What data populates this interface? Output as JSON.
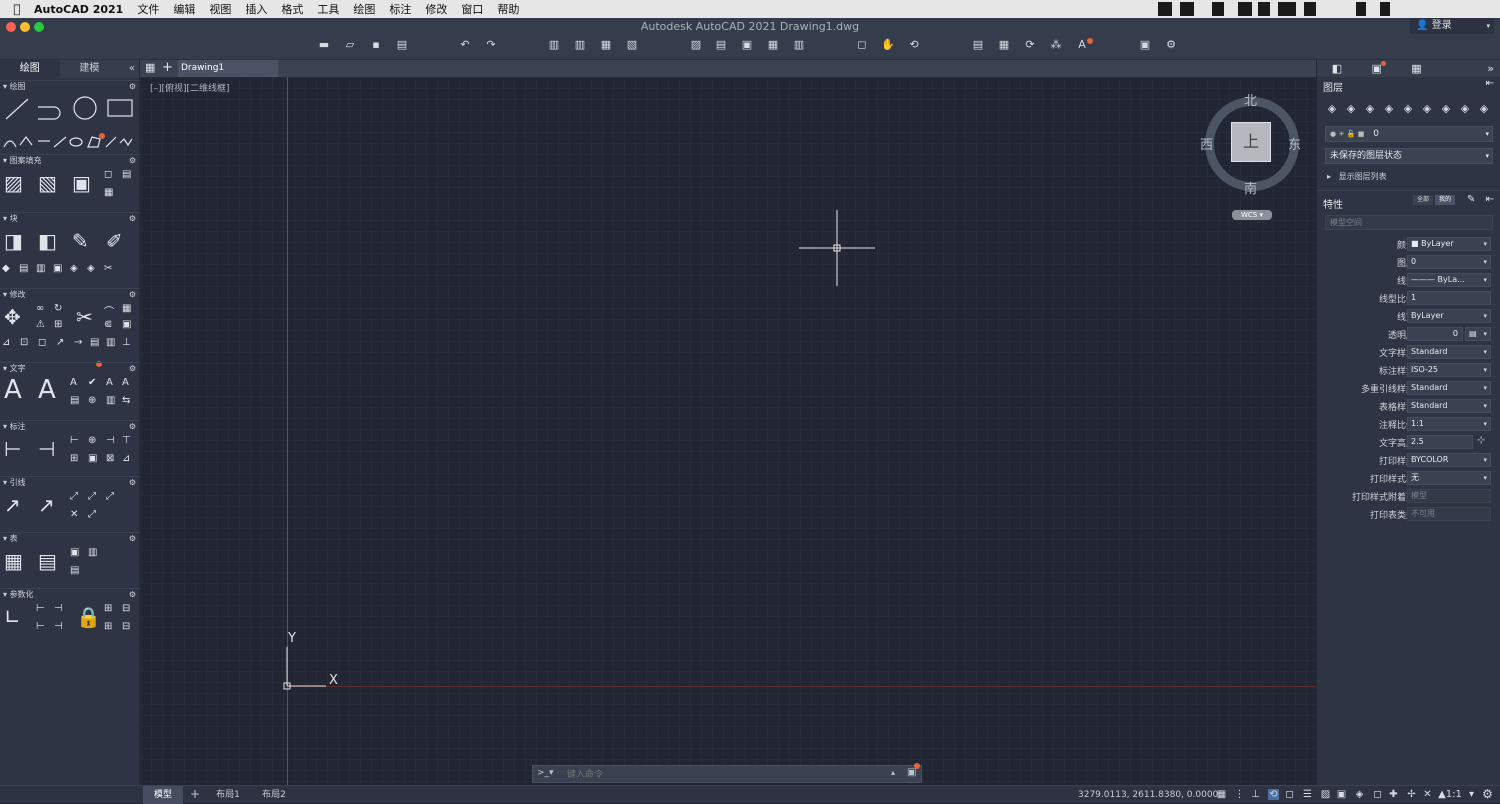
{
  "menubar": {
    "app": "AutoCAD 2021",
    "items": [
      "文件",
      "编辑",
      "视图",
      "插入",
      "格式",
      "工具",
      "绘图",
      "标注",
      "修改",
      "窗口",
      "帮助"
    ]
  },
  "window": {
    "title": "Autodesk AutoCAD 2021    Drawing1.dwg",
    "login": "登录"
  },
  "left_panel": {
    "tabs": [
      "绘图",
      "建模"
    ],
    "sections": [
      "绘图",
      "图案填充",
      "块",
      "修改",
      "文字",
      "标注",
      "引线",
      "表",
      "参数化"
    ]
  },
  "drawing_tabs": {
    "active": "Drawing1"
  },
  "canvas": {
    "view_label": "[–][俯视][二维线框]",
    "compass": {
      "north": "北",
      "south": "南",
      "east": "东",
      "west": "西",
      "top": "上"
    },
    "wcs": "WCS",
    "axis_y": "Y",
    "axis_x": "X"
  },
  "command": {
    "prompt": ">_▾",
    "placeholder": "键入命令"
  },
  "status": {
    "layouts": [
      "模型",
      "布局1",
      "布局2"
    ],
    "coords": "3279.0113, 2611.8380, 0.0000",
    "scale": "1:1"
  },
  "layers": {
    "title": "图层",
    "current_layer": "0",
    "layer_state": "未保存的图层状态",
    "show_list": "显示图层列表"
  },
  "properties": {
    "title": "特性",
    "btn_all": "全部",
    "btn_mine": "我的",
    "space": "模型空间",
    "rows": [
      {
        "label": "颜色",
        "value": "■ ByLayer",
        "disabled": false
      },
      {
        "label": "图层",
        "value": "0",
        "disabled": false
      },
      {
        "label": "线型",
        "value": "——— ByLa...",
        "disabled": false
      },
      {
        "label": "线型比例",
        "value": "1",
        "disabled": false
      },
      {
        "label": "线宽",
        "value": "ByLayer",
        "disabled": false
      },
      {
        "label": "透明度",
        "value": "0",
        "disabled": false
      },
      {
        "label": "文字样式",
        "value": "Standard",
        "disabled": false
      },
      {
        "label": "标注样式",
        "value": "ISO-25",
        "disabled": false
      },
      {
        "label": "多重引线样式",
        "value": "Standard",
        "disabled": false
      },
      {
        "label": "表格样式",
        "value": "Standard",
        "disabled": false
      },
      {
        "label": "注释比例",
        "value": "1:1",
        "disabled": false
      },
      {
        "label": "文字高度",
        "value": "2.5",
        "disabled": false
      },
      {
        "label": "打印样式",
        "value": "BYCOLOR",
        "disabled": false
      },
      {
        "label": "打印样式表",
        "value": "无",
        "disabled": false
      },
      {
        "label": "打印样式附着到",
        "value": "模型",
        "disabled": true
      },
      {
        "label": "打印表类型",
        "value": "不可用",
        "disabled": true
      }
    ]
  },
  "colors": {
    "accent": "#e8623a",
    "canvas": "#212632",
    "panel": "#2e3443"
  }
}
